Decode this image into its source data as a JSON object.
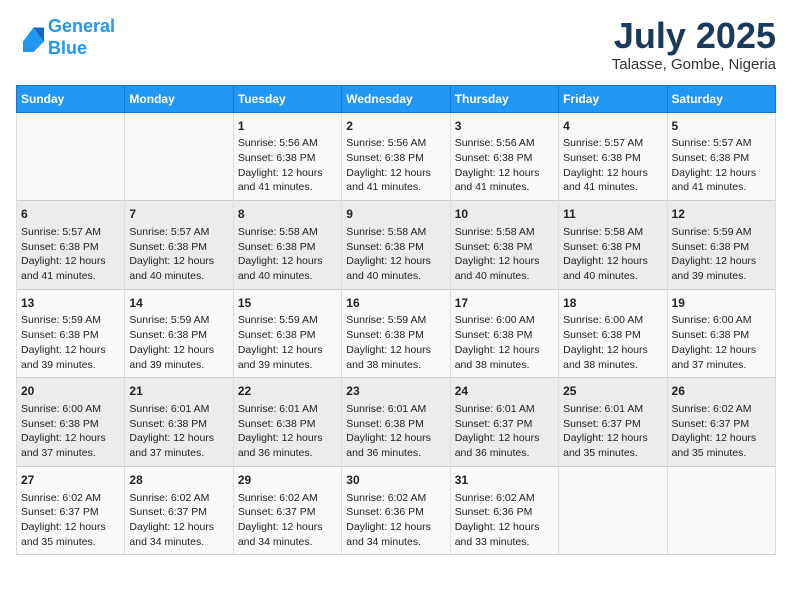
{
  "header": {
    "logo_line1": "General",
    "logo_line2": "Blue",
    "month": "July 2025",
    "location": "Talasse, Gombe, Nigeria"
  },
  "weekdays": [
    "Sunday",
    "Monday",
    "Tuesday",
    "Wednesday",
    "Thursday",
    "Friday",
    "Saturday"
  ],
  "weeks": [
    [
      {
        "day": "",
        "info": ""
      },
      {
        "day": "",
        "info": ""
      },
      {
        "day": "1",
        "info": "Sunrise: 5:56 AM\nSunset: 6:38 PM\nDaylight: 12 hours and 41 minutes."
      },
      {
        "day": "2",
        "info": "Sunrise: 5:56 AM\nSunset: 6:38 PM\nDaylight: 12 hours and 41 minutes."
      },
      {
        "day": "3",
        "info": "Sunrise: 5:56 AM\nSunset: 6:38 PM\nDaylight: 12 hours and 41 minutes."
      },
      {
        "day": "4",
        "info": "Sunrise: 5:57 AM\nSunset: 6:38 PM\nDaylight: 12 hours and 41 minutes."
      },
      {
        "day": "5",
        "info": "Sunrise: 5:57 AM\nSunset: 6:38 PM\nDaylight: 12 hours and 41 minutes."
      }
    ],
    [
      {
        "day": "6",
        "info": "Sunrise: 5:57 AM\nSunset: 6:38 PM\nDaylight: 12 hours and 41 minutes."
      },
      {
        "day": "7",
        "info": "Sunrise: 5:57 AM\nSunset: 6:38 PM\nDaylight: 12 hours and 40 minutes."
      },
      {
        "day": "8",
        "info": "Sunrise: 5:58 AM\nSunset: 6:38 PM\nDaylight: 12 hours and 40 minutes."
      },
      {
        "day": "9",
        "info": "Sunrise: 5:58 AM\nSunset: 6:38 PM\nDaylight: 12 hours and 40 minutes."
      },
      {
        "day": "10",
        "info": "Sunrise: 5:58 AM\nSunset: 6:38 PM\nDaylight: 12 hours and 40 minutes."
      },
      {
        "day": "11",
        "info": "Sunrise: 5:58 AM\nSunset: 6:38 PM\nDaylight: 12 hours and 40 minutes."
      },
      {
        "day": "12",
        "info": "Sunrise: 5:59 AM\nSunset: 6:38 PM\nDaylight: 12 hours and 39 minutes."
      }
    ],
    [
      {
        "day": "13",
        "info": "Sunrise: 5:59 AM\nSunset: 6:38 PM\nDaylight: 12 hours and 39 minutes."
      },
      {
        "day": "14",
        "info": "Sunrise: 5:59 AM\nSunset: 6:38 PM\nDaylight: 12 hours and 39 minutes."
      },
      {
        "day": "15",
        "info": "Sunrise: 5:59 AM\nSunset: 6:38 PM\nDaylight: 12 hours and 39 minutes."
      },
      {
        "day": "16",
        "info": "Sunrise: 5:59 AM\nSunset: 6:38 PM\nDaylight: 12 hours and 38 minutes."
      },
      {
        "day": "17",
        "info": "Sunrise: 6:00 AM\nSunset: 6:38 PM\nDaylight: 12 hours and 38 minutes."
      },
      {
        "day": "18",
        "info": "Sunrise: 6:00 AM\nSunset: 6:38 PM\nDaylight: 12 hours and 38 minutes."
      },
      {
        "day": "19",
        "info": "Sunrise: 6:00 AM\nSunset: 6:38 PM\nDaylight: 12 hours and 37 minutes."
      }
    ],
    [
      {
        "day": "20",
        "info": "Sunrise: 6:00 AM\nSunset: 6:38 PM\nDaylight: 12 hours and 37 minutes."
      },
      {
        "day": "21",
        "info": "Sunrise: 6:01 AM\nSunset: 6:38 PM\nDaylight: 12 hours and 37 minutes."
      },
      {
        "day": "22",
        "info": "Sunrise: 6:01 AM\nSunset: 6:38 PM\nDaylight: 12 hours and 36 minutes."
      },
      {
        "day": "23",
        "info": "Sunrise: 6:01 AM\nSunset: 6:38 PM\nDaylight: 12 hours and 36 minutes."
      },
      {
        "day": "24",
        "info": "Sunrise: 6:01 AM\nSunset: 6:37 PM\nDaylight: 12 hours and 36 minutes."
      },
      {
        "day": "25",
        "info": "Sunrise: 6:01 AM\nSunset: 6:37 PM\nDaylight: 12 hours and 35 minutes."
      },
      {
        "day": "26",
        "info": "Sunrise: 6:02 AM\nSunset: 6:37 PM\nDaylight: 12 hours and 35 minutes."
      }
    ],
    [
      {
        "day": "27",
        "info": "Sunrise: 6:02 AM\nSunset: 6:37 PM\nDaylight: 12 hours and 35 minutes."
      },
      {
        "day": "28",
        "info": "Sunrise: 6:02 AM\nSunset: 6:37 PM\nDaylight: 12 hours and 34 minutes."
      },
      {
        "day": "29",
        "info": "Sunrise: 6:02 AM\nSunset: 6:37 PM\nDaylight: 12 hours and 34 minutes."
      },
      {
        "day": "30",
        "info": "Sunrise: 6:02 AM\nSunset: 6:36 PM\nDaylight: 12 hours and 34 minutes."
      },
      {
        "day": "31",
        "info": "Sunrise: 6:02 AM\nSunset: 6:36 PM\nDaylight: 12 hours and 33 minutes."
      },
      {
        "day": "",
        "info": ""
      },
      {
        "day": "",
        "info": ""
      }
    ]
  ]
}
